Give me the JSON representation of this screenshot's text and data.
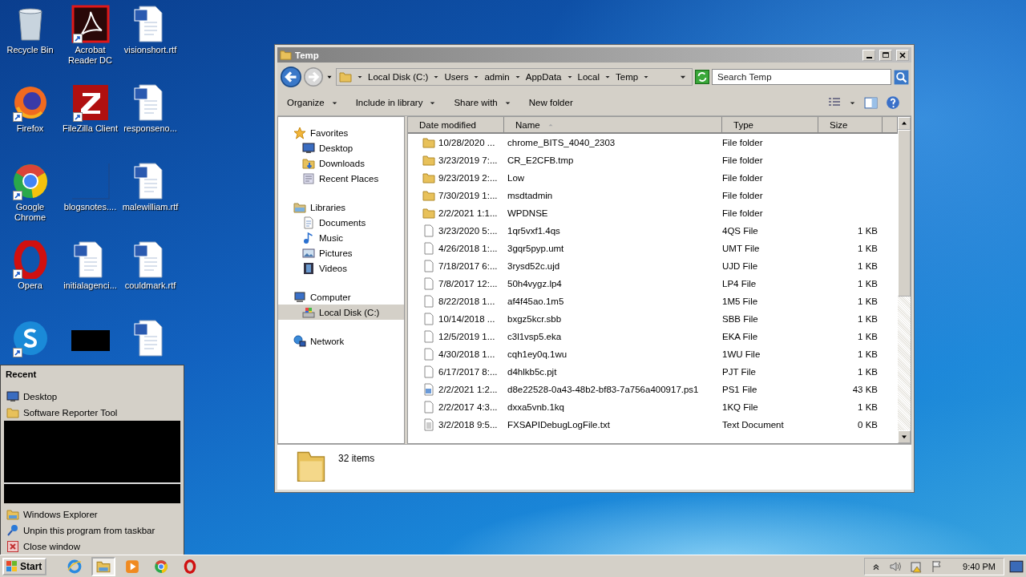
{
  "desktop": {
    "icons": [
      {
        "label": "Recycle Bin",
        "kind": "recycle",
        "shortcut": false
      },
      {
        "label": "Firefox",
        "kind": "firefox",
        "shortcut": true
      },
      {
        "label": "Google Chrome",
        "kind": "chrome",
        "shortcut": true
      },
      {
        "label": "Opera",
        "kind": "opera",
        "shortcut": true
      },
      {
        "kind": "skype",
        "shortcut": true
      },
      {
        "label": "Acrobat Reader DC",
        "kind": "acrobat",
        "shortcut": true
      },
      {
        "label": "FileZilla Client",
        "kind": "filezilla",
        "shortcut": true
      },
      {
        "label": "blogsnotes....",
        "kind": "blank",
        "shortcut": false
      },
      {
        "label": "initialagenci...",
        "kind": "word",
        "shortcut": false
      },
      {
        "kind": "redacted",
        "shortcut": false
      },
      {
        "label": "visionshort.rtf",
        "kind": "word",
        "shortcut": false
      },
      {
        "label": "responseno...",
        "kind": "word",
        "shortcut": false
      },
      {
        "label": "malewilliam.rtf",
        "kind": "word",
        "shortcut": false
      },
      {
        "label": "couldmark.rtf",
        "kind": "word",
        "shortcut": false
      },
      {
        "kind": "word",
        "shortcut": false
      }
    ]
  },
  "jump_list": {
    "heading": "Recent",
    "recent": [
      {
        "label": "Desktop",
        "kind": "desktop"
      },
      {
        "label": "Software Reporter Tool",
        "kind": "folder"
      }
    ],
    "tasks": [
      {
        "label": "Windows Explorer",
        "kind": "explorer"
      },
      {
        "label": "Unpin this program from taskbar",
        "kind": "unpin"
      },
      {
        "label": "Close window",
        "kind": "close"
      }
    ]
  },
  "explorer": {
    "title": "Temp",
    "breadcrumbs": [
      "Local Disk (C:)",
      "Users",
      "admin",
      "AppData",
      "Local",
      "Temp"
    ],
    "search": {
      "placeholder": "Search Temp"
    },
    "toolbar": [
      {
        "label": "Organize",
        "dropdown": true
      },
      {
        "label": "Include in library",
        "dropdown": true
      },
      {
        "label": "Share with",
        "dropdown": true
      },
      {
        "label": "New folder",
        "dropdown": false
      }
    ],
    "nav": [
      {
        "label": "Favorites",
        "kind": "star",
        "selected": false,
        "children": [
          {
            "label": "Desktop",
            "kind": "desktop",
            "selected": false
          },
          {
            "label": "Downloads",
            "kind": "downloads",
            "selected": false
          },
          {
            "label": "Recent Places",
            "kind": "recent",
            "selected": false
          }
        ]
      },
      {
        "label": "Libraries",
        "kind": "libraries",
        "selected": false,
        "children": [
          {
            "label": "Documents",
            "kind": "documents",
            "selected": false
          },
          {
            "label": "Music",
            "kind": "music",
            "selected": false
          },
          {
            "label": "Pictures",
            "kind": "pictures",
            "selected": false
          },
          {
            "label": "Videos",
            "kind": "videos",
            "selected": false
          }
        ]
      },
      {
        "label": "Computer",
        "kind": "computer",
        "selected": false,
        "children": [
          {
            "label": "Local Disk (C:)",
            "kind": "drive",
            "selected": true
          }
        ]
      },
      {
        "label": "Network",
        "kind": "network",
        "selected": false
      }
    ],
    "columns": [
      {
        "label": "Date modified",
        "sorted": false
      },
      {
        "label": "Name",
        "sorted": true
      },
      {
        "label": "Type",
        "sorted": false
      },
      {
        "label": "Size",
        "sorted": false
      }
    ],
    "rows": [
      {
        "date": "10/28/2020 ...",
        "name": "chrome_BITS_4040_2303",
        "type": "File folder",
        "kind": "folder"
      },
      {
        "date": "3/23/2019 7:...",
        "name": "CR_E2CFB.tmp",
        "type": "File folder",
        "kind": "folder"
      },
      {
        "date": "9/23/2019 2:...",
        "name": "Low",
        "type": "File folder",
        "kind": "folder"
      },
      {
        "date": "7/30/2019 1:...",
        "name": "msdtadmin",
        "type": "File folder",
        "kind": "folder"
      },
      {
        "date": "2/2/2021 1:1...",
        "name": "WPDNSE",
        "type": "File folder",
        "kind": "folder"
      },
      {
        "date": "3/23/2020 5:...",
        "name": "1qr5vxf1.4qs",
        "type": "4QS File",
        "size": "1 KB",
        "kind": "file"
      },
      {
        "date": "4/26/2018 1:...",
        "name": "3gqr5pyp.umt",
        "type": "UMT File",
        "size": "1 KB",
        "kind": "file"
      },
      {
        "date": "7/18/2017 6:...",
        "name": "3rysd52c.ujd",
        "type": "UJD File",
        "size": "1 KB",
        "kind": "file"
      },
      {
        "date": "7/8/2017 12:...",
        "name": "50h4vygz.lp4",
        "type": "LP4 File",
        "size": "1 KB",
        "kind": "file"
      },
      {
        "date": "8/22/2018 1...",
        "name": "af4f45ao.1m5",
        "type": "1M5 File",
        "size": "1 KB",
        "kind": "file"
      },
      {
        "date": "10/14/2018 ...",
        "name": "bxgz5kcr.sbb",
        "type": "SBB File",
        "size": "1 KB",
        "kind": "file"
      },
      {
        "date": "12/5/2019 1...",
        "name": "c3l1vsp5.eka",
        "type": "EKA File",
        "size": "1 KB",
        "kind": "file"
      },
      {
        "date": "4/30/2018 1...",
        "name": "cqh1ey0q.1wu",
        "type": "1WU File",
        "size": "1 KB",
        "kind": "file"
      },
      {
        "date": "6/17/2017 8:...",
        "name": "d4hlkb5c.pjt",
        "type": "PJT File",
        "size": "1 KB",
        "kind": "file"
      },
      {
        "date": "2/2/2021 1:2...",
        "name": "d8e22528-0a43-48b2-bf83-7a756a400917.ps1",
        "type": "PS1 File",
        "size": "43 KB",
        "kind": "script"
      },
      {
        "date": "2/2/2017 4:3...",
        "name": "dxxa5vnb.1kq",
        "type": "1KQ File",
        "size": "1 KB",
        "kind": "file"
      },
      {
        "date": "3/2/2018 9:5...",
        "name": "FXSAPIDebugLogFile.txt",
        "type": "Text Document",
        "size": "0 KB",
        "kind": "text"
      }
    ],
    "item_count": "32 items"
  },
  "taskbar": {
    "start": "Start",
    "apps": [
      {
        "kind": "ie",
        "selected": false
      },
      {
        "kind": "explorer",
        "selected": true
      },
      {
        "kind": "media",
        "selected": false
      },
      {
        "kind": "chrome",
        "selected": false
      },
      {
        "kind": "opera",
        "selected": false
      }
    ],
    "clock": "9:40 PM"
  }
}
